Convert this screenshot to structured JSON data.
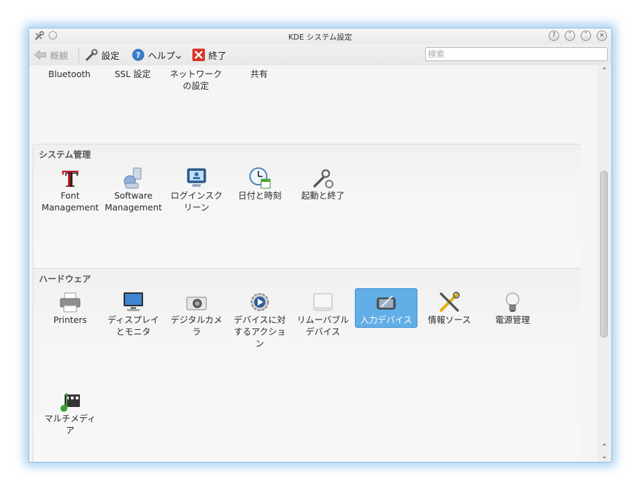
{
  "window": {
    "title": "KDE システム設定"
  },
  "toolbar": {
    "overview": "概観",
    "settings": "設定",
    "help": "ヘルプ",
    "quit": "終了",
    "search_placeholder": "検索"
  },
  "top_items": [
    {
      "label": "Bluetooth"
    },
    {
      "label": "SSL 設定"
    },
    {
      "label": "ネットワーク\nの設定"
    },
    {
      "label": "共有"
    }
  ],
  "system": {
    "title": "システム管理",
    "items": [
      {
        "label": "Font\nManagement",
        "icon": "font-icon"
      },
      {
        "label": "Software\nManagement",
        "icon": "software-icon"
      },
      {
        "label": "ログインスク\nリーン",
        "icon": "login-screen-icon"
      },
      {
        "label": "日付と時刻",
        "icon": "clock-icon"
      },
      {
        "label": "起動と終了",
        "icon": "startup-shutdown-icon"
      }
    ]
  },
  "hardware": {
    "title": "ハードウェア",
    "items": [
      {
        "label": "Printers",
        "icon": "printer-icon"
      },
      {
        "label": "ディスプレイ\nとモニタ",
        "icon": "monitor-icon"
      },
      {
        "label": "デジタルカメ\nラ",
        "icon": "camera-icon"
      },
      {
        "label": "デバイスに対\nするアクショ\nン",
        "icon": "device-actions-icon"
      },
      {
        "label": "リムーバブル\nデバイス",
        "icon": "removable-device-icon"
      },
      {
        "label": "入力デバイス",
        "icon": "input-device-icon"
      },
      {
        "label": "情報ソース",
        "icon": "info-sources-icon"
      },
      {
        "label": "電源管理",
        "icon": "power-bulb-icon"
      },
      {
        "label": "マルチメディ\nア",
        "icon": "multimedia-icon"
      }
    ],
    "selected_index": 5
  },
  "scrollbar": {
    "position_fraction": 0.5
  },
  "colors": {
    "selection": "#62aee6",
    "window_glow": "#60aae6"
  }
}
